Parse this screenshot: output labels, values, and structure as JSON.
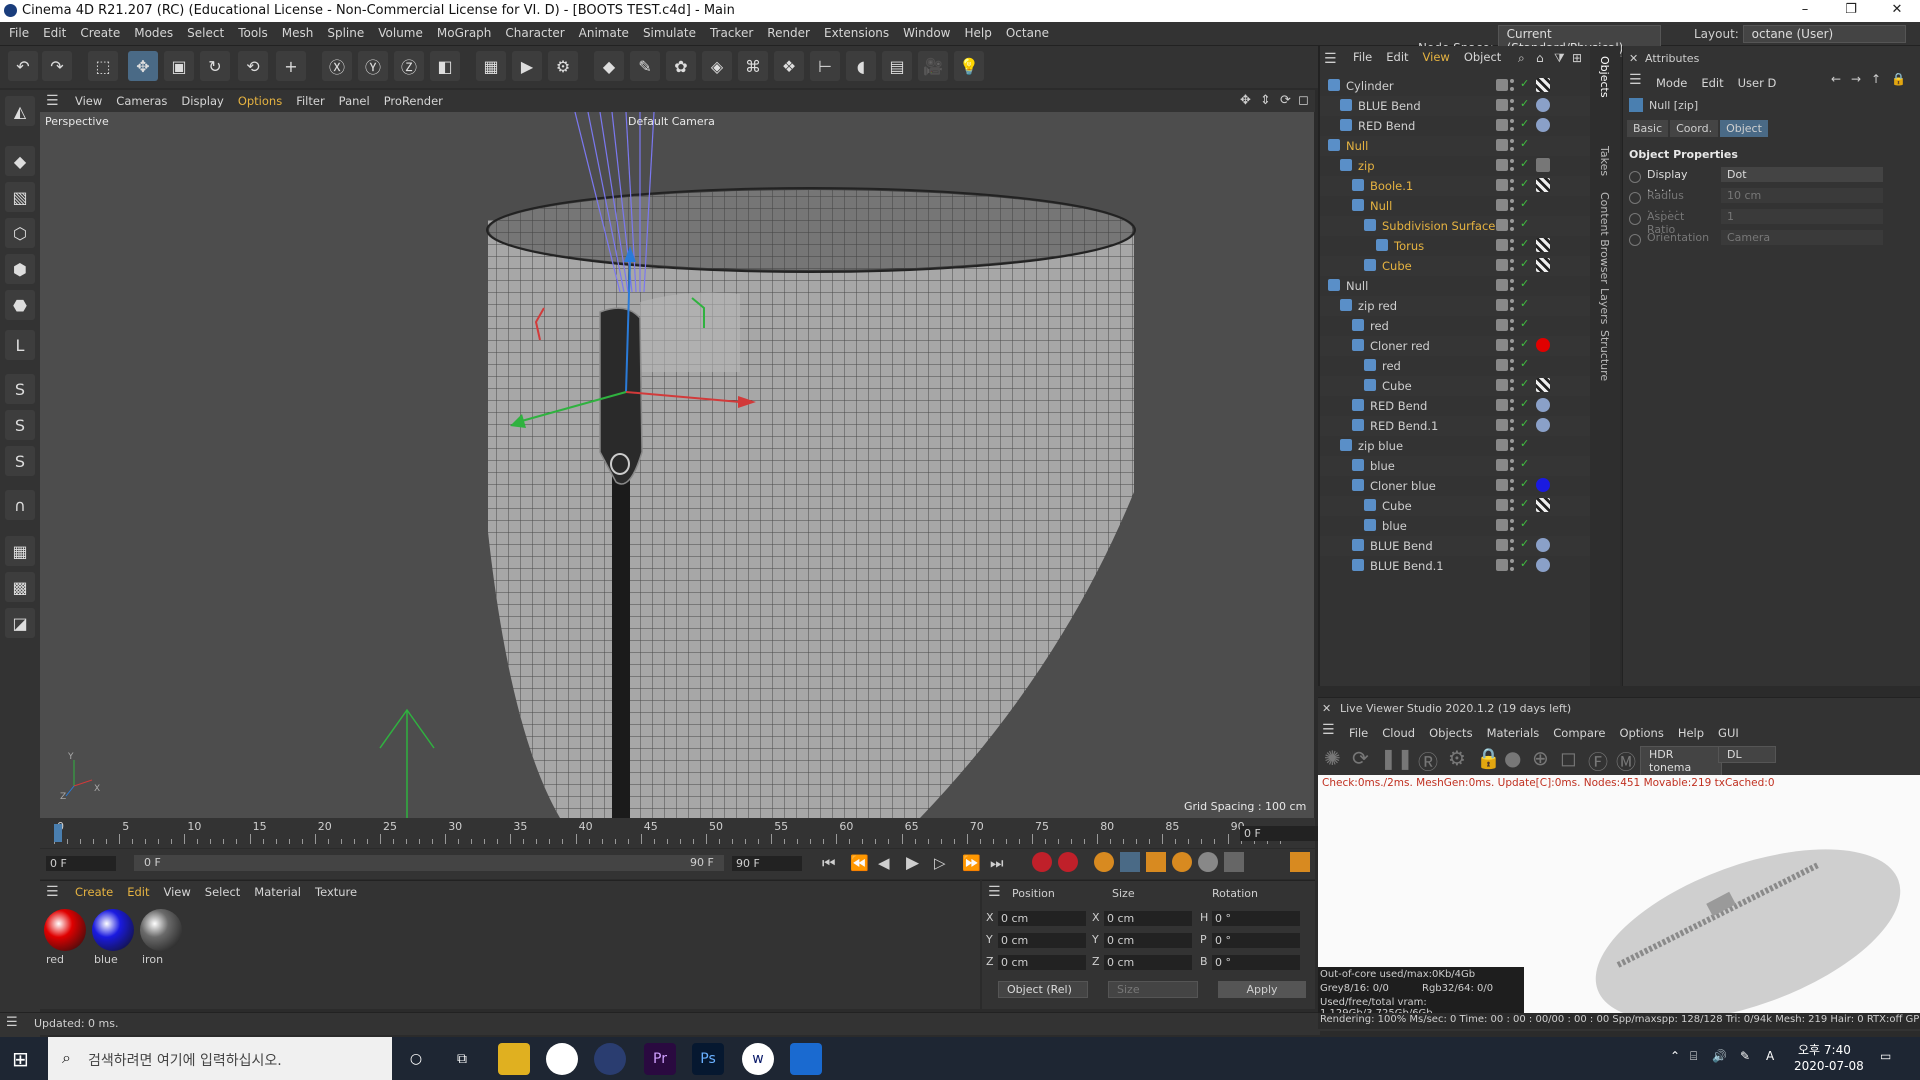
{
  "window": {
    "title": "Cinema 4D R21.207 (RC) (Educational License - Non-Commercial License for VI. D) - [BOOTS TEST.c4d] - Main",
    "minimize": "–",
    "maximize": "❐",
    "close": "✕"
  },
  "menubar": {
    "items": [
      "File",
      "Edit",
      "Create",
      "Modes",
      "Select",
      "Tools",
      "Mesh",
      "Spline",
      "Volume",
      "MoGraph",
      "Character",
      "Animate",
      "Simulate",
      "Tracker",
      "Render",
      "Extensions",
      "Window",
      "Help",
      "Octane"
    ],
    "node_space_label": "Node Space:",
    "node_space_value": "Current (Standard/Physical)",
    "layout_label": "Layout:",
    "layout_value": "octane (User)"
  },
  "viewport": {
    "menu": [
      "View",
      "Cameras",
      "Display",
      "Options",
      "Filter",
      "Panel",
      "ProRender"
    ],
    "label": "Perspective",
    "camera": "Default Camera",
    "grid_spacing": "Grid Spacing : 100 cm",
    "axis_y": "Y",
    "axis_z": "Z",
    "axis_x": "X"
  },
  "timeline": {
    "ticks": [
      "0",
      "5",
      "10",
      "15",
      "20",
      "25",
      "30",
      "35",
      "40",
      "45",
      "50",
      "55",
      "60",
      "65",
      "70",
      "75",
      "80",
      "85",
      "90"
    ],
    "current_frame": "0 F",
    "start": "0 F",
    "field2": "0 F",
    "field3": "90 F",
    "end": "90 F"
  },
  "material_manager": {
    "menu": [
      "Create",
      "Edit",
      "View",
      "Select",
      "Material",
      "Texture"
    ],
    "materials": [
      {
        "name": "red",
        "color": "#e00000"
      },
      {
        "name": "blue",
        "color": "#1a1ae0"
      },
      {
        "name": "iron",
        "color": "#6a6a6a"
      }
    ]
  },
  "coordinates": {
    "headers": [
      "Position",
      "Size",
      "Rotation"
    ],
    "rows": [
      {
        "axis": "X",
        "pos": "0 cm",
        "size_axis": "X",
        "size": "0 cm",
        "rot_axis": "H",
        "rot": "0 °"
      },
      {
        "axis": "Y",
        "pos": "0 cm",
        "size_axis": "Y",
        "size": "0 cm",
        "rot_axis": "P",
        "rot": "0 °"
      },
      {
        "axis": "Z",
        "pos": "0 cm",
        "size_axis": "Z",
        "size": "0 cm",
        "rot_axis": "B",
        "rot": "0 °"
      }
    ],
    "mode": "Object (Rel)",
    "size_mode": "Size",
    "apply": "Apply"
  },
  "status": "Updated: 0 ms.",
  "object_manager": {
    "menu": [
      "File",
      "Edit",
      "View",
      "Object"
    ],
    "objects": [
      {
        "name": "Cylinder",
        "indent": 0,
        "color": "#cfcfcf",
        "tag": "checker"
      },
      {
        "name": "BLUE Bend",
        "indent": 1,
        "color": "#cfcfcf",
        "tag": "deform"
      },
      {
        "name": "RED Bend",
        "indent": 1,
        "color": "#cfcfcf",
        "tag": "deform"
      },
      {
        "name": "Null",
        "indent": 0,
        "color": "#e6b341",
        "tag": ""
      },
      {
        "name": "zip",
        "indent": 1,
        "color": "#e6b341",
        "tag": "gray"
      },
      {
        "name": "Boole.1",
        "indent": 2,
        "color": "#e6b341",
        "tag": "checker"
      },
      {
        "name": "Null",
        "indent": 2,
        "color": "#e6b341",
        "tag": ""
      },
      {
        "name": "Subdivision Surface",
        "indent": 3,
        "color": "#e6b341",
        "tag": ""
      },
      {
        "name": "Torus",
        "indent": 4,
        "color": "#e6b341",
        "tag": "checker"
      },
      {
        "name": "Cube",
        "indent": 3,
        "color": "#e6b341",
        "tag": "checker"
      },
      {
        "name": "Null",
        "indent": 0,
        "color": "#cfcfcf",
        "tag": ""
      },
      {
        "name": "zip red",
        "indent": 1,
        "color": "#cfcfcf",
        "tag": ""
      },
      {
        "name": "red",
        "indent": 2,
        "color": "#cfcfcf",
        "tag": ""
      },
      {
        "name": "Cloner red",
        "indent": 2,
        "color": "#cfcfcf",
        "tag": "red"
      },
      {
        "name": "red",
        "indent": 3,
        "color": "#cfcfcf",
        "tag": ""
      },
      {
        "name": "Cube",
        "indent": 3,
        "color": "#cfcfcf",
        "tag": "checker"
      },
      {
        "name": "RED Bend",
        "indent": 2,
        "color": "#cfcfcf",
        "tag": "deform"
      },
      {
        "name": "RED Bend.1",
        "indent": 2,
        "color": "#cfcfcf",
        "tag": "deform"
      },
      {
        "name": "zip blue",
        "indent": 1,
        "color": "#cfcfcf",
        "tag": ""
      },
      {
        "name": "blue",
        "indent": 2,
        "color": "#cfcfcf",
        "tag": ""
      },
      {
        "name": "Cloner blue",
        "indent": 2,
        "color": "#cfcfcf",
        "tag": "blue"
      },
      {
        "name": "Cube",
        "indent": 3,
        "color": "#cfcfcf",
        "tag": "checker"
      },
      {
        "name": "blue",
        "indent": 3,
        "color": "#cfcfcf",
        "tag": ""
      },
      {
        "name": "BLUE Bend",
        "indent": 2,
        "color": "#cfcfcf",
        "tag": "deform"
      },
      {
        "name": "BLUE Bend.1",
        "indent": 2,
        "color": "#cfcfcf",
        "tag": "deform"
      }
    ]
  },
  "side_tabs": [
    "Objects",
    "Takes",
    "Content Browser",
    "Layers",
    "Structure"
  ],
  "attributes": {
    "title": "Attributes",
    "menu": [
      "Mode",
      "Edit",
      "User D"
    ],
    "object": "Null [zip]",
    "tabs": [
      "Basic",
      "Coord.",
      "Object"
    ],
    "section": "Object Properties",
    "props": [
      {
        "label": "Display . . . .",
        "value": "Dot"
      },
      {
        "label": "Radius . . . . .",
        "value": "10 cm"
      },
      {
        "label": "Aspect Ratio",
        "value": "1"
      },
      {
        "label": "Orientation",
        "value": "Camera"
      }
    ]
  },
  "live_viewer": {
    "title": "Live Viewer Studio 2020.1.2 (19 days left)",
    "menu": [
      "File",
      "Cloud",
      "Objects",
      "Materials",
      "Compare",
      "Options",
      "Help",
      "GUI"
    ],
    "tonemap": "HDR tonema",
    "mode": "DL",
    "stats": "Check:0ms./2ms. MeshGen:0ms. Update[C]:0ms. Nodes:451 Movable:219 txCached:0",
    "ooc": "Out-of-core used/max:0Kb/4Gb",
    "grey": "Grey8/16: 0/0",
    "rgb": "Rgb32/64: 0/0",
    "vram": "Used/free/total vram: 1.129Gb/3.725Gb/6Gb",
    "render_line": "Rendering: 100% Ms/sec: 0   Time: 00 : 00 : 00/00 : 00 : 00      Spp/maxspp: 128/128   Tri: 0/94k   Mesh: 219   Hair: 0   RTX:off   GP"
  },
  "taskbar": {
    "search_placeholder": "검색하려면 여기에 입력하십시오.",
    "time": "오후 7:40",
    "date": "2020-07-08"
  }
}
